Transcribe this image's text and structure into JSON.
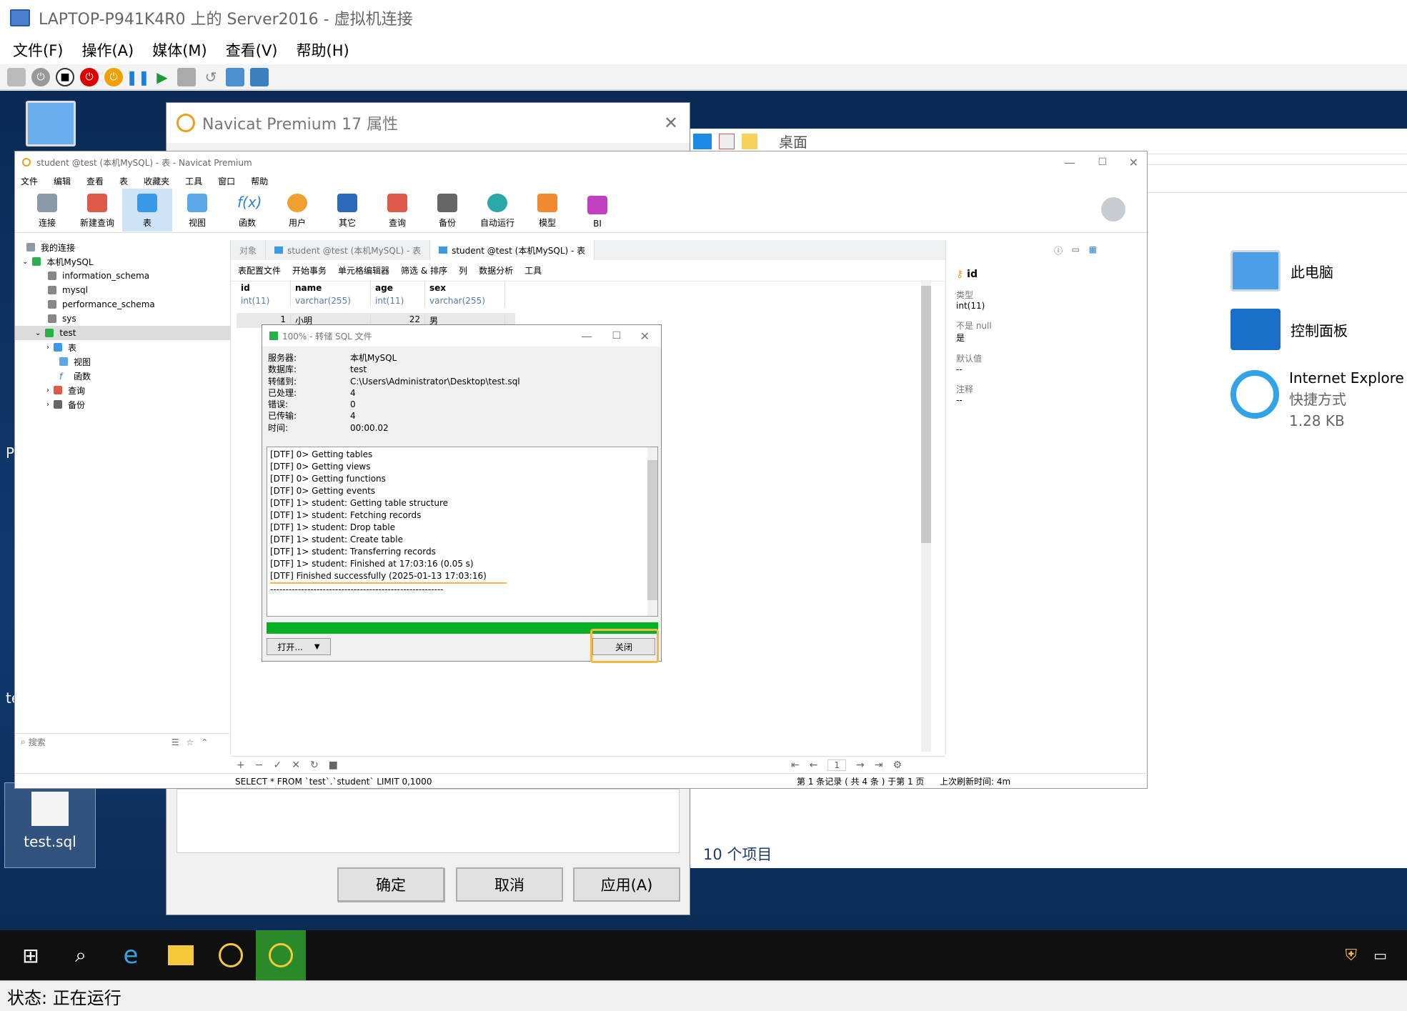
{
  "vm": {
    "title": "LAPTOP-P941K4R0 上的 Server2016 - 虚拟机连接",
    "menu": [
      "文件(F)",
      "操作(A)",
      "媒体(M)",
      "查看(V)",
      "帮助(H)"
    ],
    "status": "状态: 正在运行"
  },
  "desktop": {
    "icons": [
      {
        "name": "此电脑",
        "icon": "computer-icon"
      },
      {
        "name": "控制面板",
        "icon": "control-panel-icon"
      },
      {
        "name": "Internet Explore",
        "sub1": "快捷方式",
        "sub2": "1.28 KB",
        "icon": "ie-icon"
      }
    ],
    "file_label": "test.sql",
    "left_letters": [
      "P",
      "te"
    ]
  },
  "explorer": {
    "address": "桌面",
    "count": "10 个项目"
  },
  "props": {
    "title": "Navicat Premium 17 属性",
    "ok": "确定",
    "cancel": "取消",
    "apply": "应用(A)"
  },
  "navicat": {
    "title": "student @test (本机MySQL) - 表 - Navicat Premium",
    "menu": [
      "文件",
      "编辑",
      "查看",
      "表",
      "收藏夹",
      "工具",
      "窗口",
      "帮助"
    ],
    "toolbar": [
      "连接",
      "新建查询",
      "表",
      "视图",
      "函数",
      "用户",
      "其它",
      "查询",
      "备份",
      "自动运行",
      "模型",
      "BI"
    ],
    "tree": {
      "root": "我的连接",
      "conn": "本机MySQL",
      "dbs": [
        "information_schema",
        "mysql",
        "performance_schema",
        "sys",
        "test"
      ],
      "children": [
        "表",
        "视图",
        "函数",
        "查询",
        "备份"
      ]
    },
    "search_placeholder": "搜索",
    "tabs": [
      "对象",
      "student @test (本机MySQL) - 表",
      "student @test (本机MySQL) - 表"
    ],
    "subtool": [
      "表配置文件",
      "开始事务",
      "单元格编辑器",
      "筛选 & 排序",
      "列",
      "数据分析",
      "工具"
    ],
    "columns": [
      {
        "name": "id",
        "type": "int(11)"
      },
      {
        "name": "name",
        "type": "varchar(255)"
      },
      {
        "name": "age",
        "type": "int(11)"
      },
      {
        "name": "sex",
        "type": "varchar(255)"
      }
    ],
    "row1": [
      "1",
      "小明",
      "22",
      "男"
    ],
    "info": {
      "field": "id",
      "type_label": "类型",
      "type": "int(11)",
      "notnull_label": "不是 null",
      "notnull": "是",
      "default_label": "默认值",
      "default": "--",
      "comment_label": "注释",
      "comment": "--"
    },
    "status_sql": "SELECT * FROM `test`.`student` LIMIT 0,1000",
    "status_records": "第 1 条记录 ( 共 4 条 ) 于第 1 页",
    "status_refresh": "上次刷新时间: 4m",
    "page": "1"
  },
  "xfer": {
    "title": "100% - 转储 SQL 文件",
    "info": [
      {
        "k": "服务器:",
        "v": "本机MySQL"
      },
      {
        "k": "数据库:",
        "v": "test"
      },
      {
        "k": "转储到:",
        "v": "C:\\Users\\Administrator\\Desktop\\test.sql"
      },
      {
        "k": "已处理:",
        "v": "4"
      },
      {
        "k": "错误:",
        "v": "0"
      },
      {
        "k": "已传输:",
        "v": "4"
      },
      {
        "k": "时间:",
        "v": "00:00.02"
      }
    ],
    "log": [
      "[DTF] 0> Getting tables",
      "[DTF] 0> Getting views",
      "[DTF] 0> Getting functions",
      "[DTF] 0> Getting events",
      "[DTF] 1> student: Getting table structure",
      "[DTF] 1> student: Fetching records",
      "[DTF] 1> student: Drop table",
      "[DTF] 1> student: Create table",
      "[DTF] 1> student: Transferring records",
      "[DTF] 1> student: Finished at 17:03:16 (0.05 s)",
      "[DTF] Finished successfully (2025-01-13 17:03:16)",
      "--------------------------------------------------------"
    ],
    "progress": 100,
    "open": "打开...",
    "close": "关闭"
  }
}
